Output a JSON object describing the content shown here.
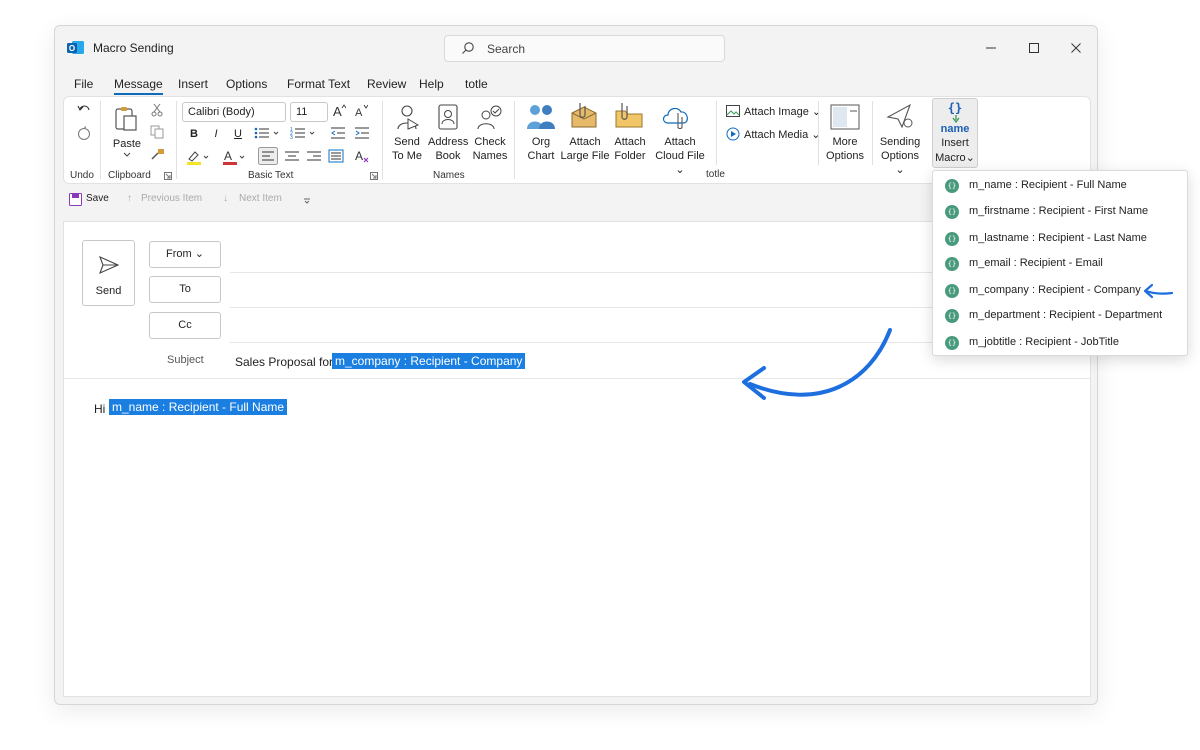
{
  "window": {
    "title": "Macro Sending"
  },
  "search": {
    "placeholder": "Search"
  },
  "menu": [
    "File",
    "Message",
    "Insert",
    "Options",
    "Format Text",
    "Review",
    "Help",
    "totle"
  ],
  "ribbon": {
    "undo": {
      "label": "Undo"
    },
    "clipboard": {
      "paste": "Paste",
      "group": "Clipboard"
    },
    "basic_text": {
      "font": "Calibri (Body)",
      "size": "11",
      "group": "Basic Text",
      "bold": "B",
      "italic": "I",
      "underline": "U"
    },
    "names": {
      "send_to_me": [
        "Send",
        "To Me"
      ],
      "address_book": [
        "Address",
        "Book"
      ],
      "check_names": [
        "Check",
        "Names"
      ],
      "group": "Names"
    },
    "totle": {
      "org_chart": [
        "Org",
        "Chart"
      ],
      "attach_large": [
        "Attach",
        "Large File"
      ],
      "attach_folder": [
        "Attach",
        "Folder"
      ],
      "attach_cloud": [
        "Attach",
        "Cloud File"
      ],
      "attach_image": "Attach Image",
      "attach_media": "Attach Media",
      "more_options": [
        "More",
        "Options"
      ],
      "sending_options": [
        "Sending",
        "Options"
      ],
      "group": "totle"
    },
    "insert_macro": {
      "glyph": "{}",
      "name": "name",
      "label": [
        "Insert",
        "Macro"
      ]
    }
  },
  "quickbar": {
    "save": "Save",
    "previous": "Previous Item",
    "next": "Next Item"
  },
  "compose": {
    "send": "Send",
    "from": "From",
    "to": "To",
    "cc": "Cc",
    "subject_label": "Subject",
    "subject_prefix": "Sales Proposal for",
    "subject_macro": "m_company : Recipient - Company",
    "body_prefix": "Hi",
    "body_macro": "m_name : Recipient - Full Name"
  },
  "macro_menu": [
    "m_name : Recipient - Full Name",
    "m_firstname : Recipient - First Name",
    "m_lastname : Recipient - Last Name",
    "m_email : Recipient - Email",
    "m_company : Recipient - Company",
    "m_department : Recipient - Department",
    "m_jobtitle : Recipient - JobTitle"
  ],
  "badge_glyph": "{}",
  "colors": {
    "accent": "#0f6cbd",
    "highlight": "#1a7fe0",
    "badge": "#4a9a7d",
    "arrow": "#1d6fe0"
  }
}
